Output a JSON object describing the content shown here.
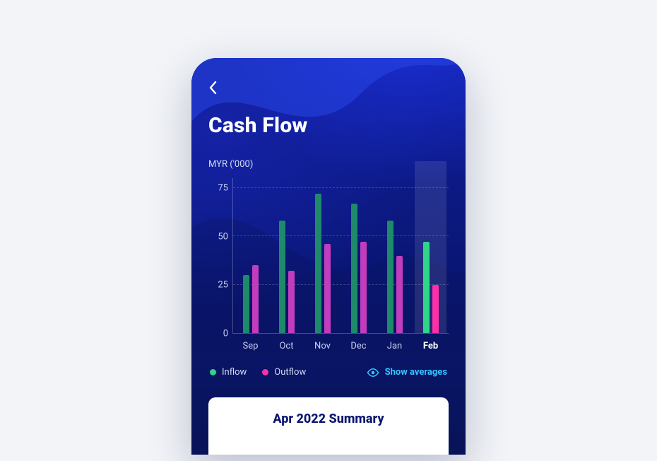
{
  "header": {
    "title": "Cash Flow"
  },
  "chart_data": {
    "type": "bar",
    "categories": [
      "Sep",
      "Oct",
      "Nov",
      "Dec",
      "Jan",
      "Feb"
    ],
    "series": [
      {
        "name": "Inflow",
        "values": [
          30,
          58,
          72,
          67,
          58,
          47
        ]
      },
      {
        "name": "Outflow",
        "values": [
          35,
          32,
          46,
          47,
          40,
          25
        ]
      }
    ],
    "highlighted_category": "Feb",
    "title": "Cash Flow",
    "xlabel": "",
    "ylabel": "MYR ('000)",
    "ylim": [
      0,
      80
    ],
    "yticks": [
      0,
      25,
      50,
      75
    ]
  },
  "legend": {
    "inflow": "Inflow",
    "outflow": "Outflow"
  },
  "actions": {
    "show_averages": "Show averages"
  },
  "summary": {
    "title": "Apr 2022 Summary"
  },
  "colors": {
    "inflow": "#2fd688",
    "outflow": "#ff2fa8",
    "outflow_dim": "#c23dbd",
    "accent_link": "#33c5ff",
    "bg_primary": "#0a1670"
  }
}
